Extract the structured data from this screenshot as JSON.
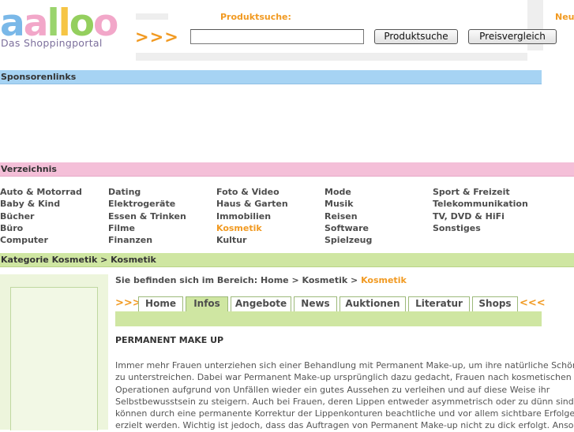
{
  "logo": {
    "letters": [
      "a",
      "a",
      "l",
      "l",
      "o",
      "o"
    ],
    "letter_colors": [
      "#7ab8e8",
      "#f2a7c9",
      "#9ad46d",
      "#f6c544",
      "#94cf5e",
      "#f2a7c9"
    ],
    "tagline": "Das Shoppingportal"
  },
  "search": {
    "heading": "Produktsuche:",
    "arrows": ">>>",
    "input_value": "",
    "search_button": "Produktsuche",
    "compare_button": "Preisvergleich",
    "new_badge": "Neu!"
  },
  "sponsor_bar": {
    "label": "Sponsorenlinks"
  },
  "directory": {
    "label": "Verzeichnis",
    "columns": [
      [
        "Auto & Motorrad",
        "Baby & Kind",
        "Bücher",
        "Büro",
        "Computer"
      ],
      [
        "Dating",
        "Elektrogeräte",
        "Essen & Trinken",
        "Filme",
        "Finanzen"
      ],
      [
        "Foto & Video",
        "Haus & Garten",
        "Immobilien",
        "Kosmetik",
        "Kultur"
      ],
      [
        "Mode",
        "Musik",
        "Reisen",
        "Software",
        "Spielzeug"
      ],
      [
        "Sport & Freizeit",
        "Telekommunikation",
        "TV, DVD & HiFi",
        "Sonstiges"
      ]
    ],
    "active_item": "Kosmetik"
  },
  "category_bar": {
    "label": "Kategorie Kosmetik > Kosmetik"
  },
  "breadcrumb": {
    "prefix": "Sie befinden sich im Bereich: Home > Kosmetik > ",
    "current": "Kosmetik"
  },
  "tabs": {
    "arrows_left": ">>>",
    "arrows_right": "<<<",
    "items": [
      "Home",
      "Infos",
      "Angebote",
      "News",
      "Auktionen",
      "Literatur",
      "Shops"
    ],
    "active": "Infos"
  },
  "article": {
    "title": "PERMANENT MAKE UP",
    "lines": [
      "Immer mehr Frauen unterziehen sich einer Behandlung mit Permanent Make-up, um ihre natürliche Schönheit",
      "zu unterstreichen. Dabei war Permanent Make-up ursprünglich dazu gedacht, Frauen nach kosmetischen",
      "Operationen aufgrund von Unfällen wieder ein gutes Aussehen zu verleihen und auf diese Weise ihr",
      "Selbstbewusstsein zu steigern. Auch bei Frauen, deren Lippen entweder asymmetrisch oder zu dünn sind,",
      "können durch eine permanente Korrektur der Lippenkonturen beachtliche und vor allem sichtbare Erfolge",
      "erzielt werden. Wichtig ist jedoch, dass das Auftragen von Permanent Make-up nicht zu dick erfolgt. Ansonsten"
    ]
  }
}
